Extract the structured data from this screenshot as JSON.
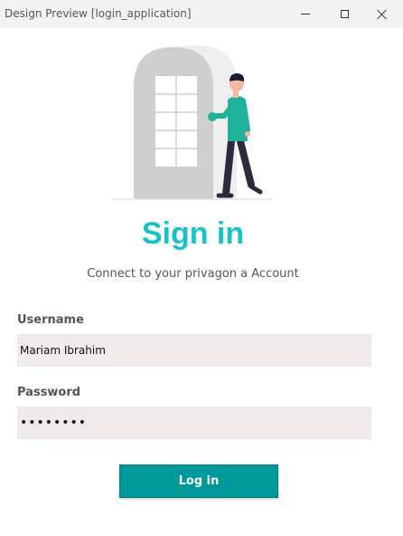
{
  "window": {
    "title": "Design Preview [login_application]"
  },
  "heading": "Sign in",
  "subtitle": "Connect to your privagon a Account",
  "username": {
    "label": "Username",
    "value": "Mariam Ibrahim"
  },
  "password": {
    "label": "Password",
    "value": "••••••••"
  },
  "login_button": "Log in",
  "colors": {
    "accent": "#17c3c7",
    "button": "#009999",
    "field_bg": "#f0ebea"
  },
  "icons": {
    "illustration": "person-opening-door-illustration"
  }
}
